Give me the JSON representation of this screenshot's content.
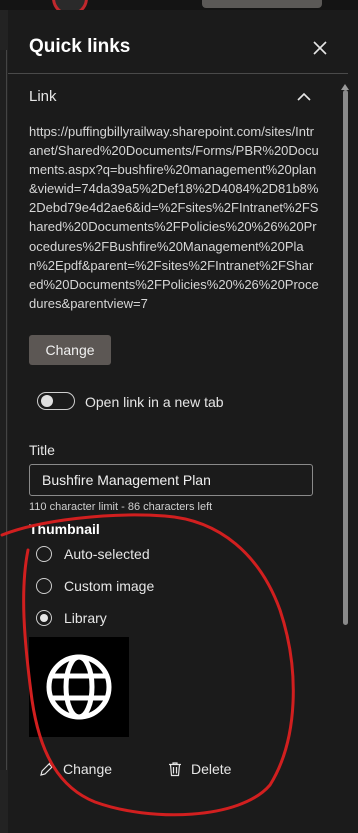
{
  "panel": {
    "title": "Quick links",
    "close_icon": "close-icon"
  },
  "link_section": {
    "heading": "Link",
    "url": "https://puffingbillyrailway.sharepoint.com/sites/Intranet/Shared%20Documents/Forms/PBR%20Documents.aspx?q=bushfire%20management%20plan&viewid=74da39a5%2Def18%2D4084%2D81b8%2Debd79e4d2ae6&id=%2Fsites%2FIntranet%2FShared%20Documents%2FPolicies%20%26%20Procedures%2FBushfire%20Management%20Plan%2Epdf&parent=%2Fsites%2FIntranet%2FShared%20Documents%2FPolicies%20%26%20Procedures&parentview=7",
    "change_label": "Change",
    "new_tab_label": "Open link in a new tab",
    "new_tab_on": false
  },
  "title_field": {
    "label": "Title",
    "value": "Bushfire Management Plan",
    "hint": "110 character limit - 86 characters left"
  },
  "thumbnail": {
    "label": "Thumbnail",
    "options": [
      {
        "label": "Auto-selected",
        "checked": false
      },
      {
        "label": "Custom image",
        "checked": false
      },
      {
        "label": "Library",
        "checked": true
      }
    ],
    "preview_icon": "globe-icon",
    "change_label": "Change",
    "delete_label": "Delete"
  },
  "colors": {
    "background": "#1b1b1b",
    "button": "#5c5754",
    "annotation": "#d11f1f"
  }
}
